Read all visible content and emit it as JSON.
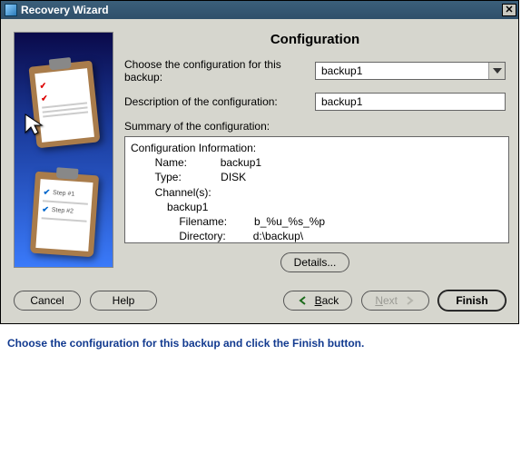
{
  "window": {
    "title": "Recovery Wizard"
  },
  "page_title": "Configuration",
  "labels": {
    "choose_config": "Choose the configuration for this backup:",
    "description": "Description of the configuration:",
    "summary": "Summary of the configuration:"
  },
  "fields": {
    "config_selected": "backup1",
    "description_value": "backup1"
  },
  "summary": {
    "header": "Configuration Information:",
    "name_label": "Name:",
    "name_value": "backup1",
    "type_label": "Type:",
    "type_value": "DISK",
    "channels_label": "Channel(s):",
    "channel_name": "backup1",
    "filename_label": "Filename:",
    "filename_value": "b_%u_%s_%p",
    "directory_label": "Directory:",
    "directory_value": "d:\\backup\\"
  },
  "buttons": {
    "details": "Details...",
    "cancel": "Cancel",
    "help": "Help",
    "back": "Back",
    "next": "Next",
    "finish": "Finish"
  },
  "instruction": "Choose the configuration for this backup and click the Finish button."
}
